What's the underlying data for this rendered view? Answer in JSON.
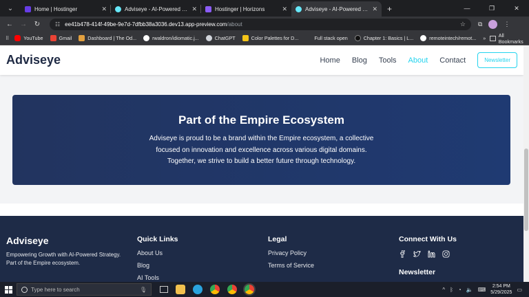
{
  "browser": {
    "tabs": [
      {
        "title": "Home | Hostinger",
        "color": "#673de6"
      },
      {
        "title": "Adviseye - AI-Powered Strategy",
        "color": "#67e8f9"
      },
      {
        "title": "Hostinger | Horizons",
        "color": "#8b5cf6"
      },
      {
        "title": "Adviseye - AI-Powered Strategy",
        "color": "#67e8f9"
      }
    ],
    "url_host": "ee41b478-414f-49be-9e7d-7dfbb38a3036.dev13.app-preview.com",
    "url_path": "/about",
    "bookmarks": [
      {
        "label": "YouTube",
        "color": "#ff0000"
      },
      {
        "label": "Gmail",
        "color": "#ea4335"
      },
      {
        "label": "Dashboard | The Od...",
        "color": "#e2a03f"
      },
      {
        "label": "rwaldron/idiomatic.j...",
        "color": "#ffffff"
      },
      {
        "label": "ChatGPT",
        "color": "#d1d5db"
      },
      {
        "label": "Color Palettes for D...",
        "color": "#f5c518"
      },
      {
        "label": "Full stack open",
        "color": "#35363a"
      },
      {
        "label": "Chapter 1: Basics | L...",
        "color": "#111111"
      },
      {
        "label": "remoteintech/remot...",
        "color": "#ffffff"
      }
    ],
    "all_bookmarks": "All Bookmarks"
  },
  "site": {
    "brand": "Adviseye",
    "nav": [
      "Home",
      "Blog",
      "Tools",
      "About",
      "Contact"
    ],
    "active_nav": "About",
    "newsletter_button": "Newsletter",
    "accent": "#22d3ee"
  },
  "ecosystem": {
    "title": "Part of the Empire Ecosystem",
    "body": "Adviseye is proud to be a brand within the Empire ecosystem, a collective focused on innovation and excellence across various digital domains. Together, we strive to build a better future through technology."
  },
  "footer": {
    "brand": "Adviseye",
    "tagline": "Empowering Growth with AI-Powered Strategy. Part of the Empire ecosystem.",
    "quick_links_title": "Quick Links",
    "quick_links": [
      "About Us",
      "Blog",
      "AI Tools"
    ],
    "legal_title": "Legal",
    "legal_links": [
      "Privacy Policy",
      "Terms of Service"
    ],
    "connect_title": "Connect With Us",
    "social_icons": [
      "facebook-icon",
      "twitter-icon",
      "linkedin-icon",
      "instagram-icon"
    ],
    "newsletter_title": "Newsletter"
  },
  "taskbar": {
    "search_placeholder": "Type here to search",
    "time": "2:54 PM",
    "date": "5/29/2025"
  }
}
